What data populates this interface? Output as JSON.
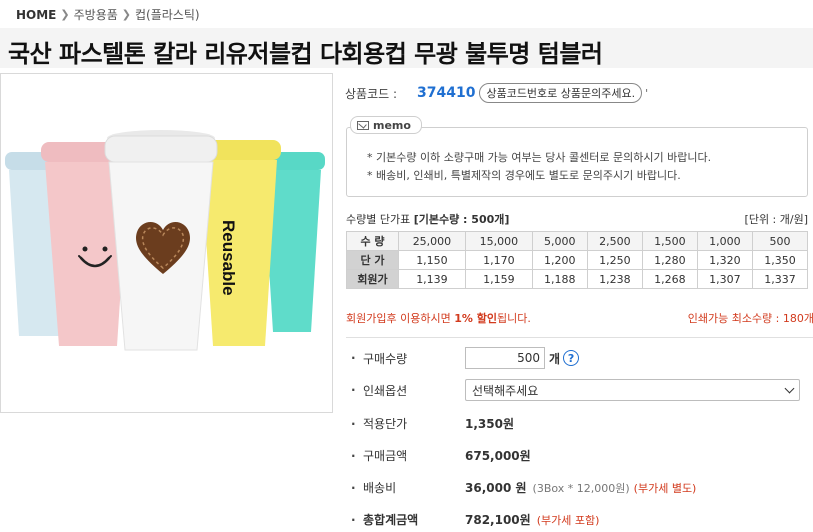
{
  "breadcrumb": {
    "home": "HOME",
    "items": [
      "주방용품",
      "컵(플라스틱)"
    ]
  },
  "product": {
    "title": "국산 파스텔톤 칼라 리유저블컵 다회용컵 무광 불투명 텀블러",
    "image_text": "Reusable",
    "code_label": "상품코드 :",
    "code_value": "374410",
    "code_button": "상품코드번호로 상품문의주세요.",
    "code_tick": "'"
  },
  "memo": {
    "tab_label": "memo",
    "lines": [
      "* 기본수량 이하 소량구매 가능 여부는 당사 콜센터로 문의하시기 바랍니다.",
      "* 배송비, 인쇄비, 특별제작의 경우에도 별도로 문의주시기 바랍니다."
    ]
  },
  "price_table": {
    "caption_prefix": "수량별 단가표 ",
    "caption_bold": "[기본수량 : 500개]",
    "unit_note": "[단위 : 개/원]",
    "rows": [
      {
        "header": "수 량",
        "cells": [
          "25,000",
          "15,000",
          "5,000",
          "2,500",
          "1,500",
          "1,000",
          "500"
        ]
      },
      {
        "header": "단 가",
        "cells": [
          "1,150",
          "1,170",
          "1,200",
          "1,250",
          "1,280",
          "1,320",
          "1,350"
        ]
      },
      {
        "header": "회원가",
        "cells": [
          "1,139",
          "1,159",
          "1,188",
          "1,238",
          "1,268",
          "1,307",
          "1,337"
        ]
      }
    ]
  },
  "notices": {
    "member_prefix": "회원가입후 이용하시면 ",
    "member_bold": "1% 할인",
    "member_suffix": "됩니다.",
    "min_print": "인쇄가능 최소수량 : 180개"
  },
  "order": {
    "bullet": "·",
    "qty_label": "구매수량",
    "qty_value": "500",
    "qty_unit": "개",
    "help_glyph": "?",
    "print_label": "인쇄옵션",
    "print_selected": "선택해주세요",
    "unit_price_label": "적용단가",
    "unit_price_value": "1,350원",
    "amount_label": "구매금액",
    "amount_value": "675,000원",
    "shipping_label": "배송비",
    "shipping_value": "36,000 원",
    "shipping_detail": "(3Box * 12,000원)",
    "shipping_vat": "(부가세 별도)",
    "total_label": "총합계금액",
    "total_value": "782,100원",
    "total_vat": "(부가세 포함)"
  },
  "colors": {
    "accent_blue": "#1f6fd1",
    "notice_red": "#d23a1d",
    "cup_blue": "#cfe3ec",
    "cup_pink": "#f4c7c9",
    "cup_white": "#f2f2f2",
    "cup_yellow": "#f6ea6e",
    "cup_teal": "#5fdcca"
  }
}
